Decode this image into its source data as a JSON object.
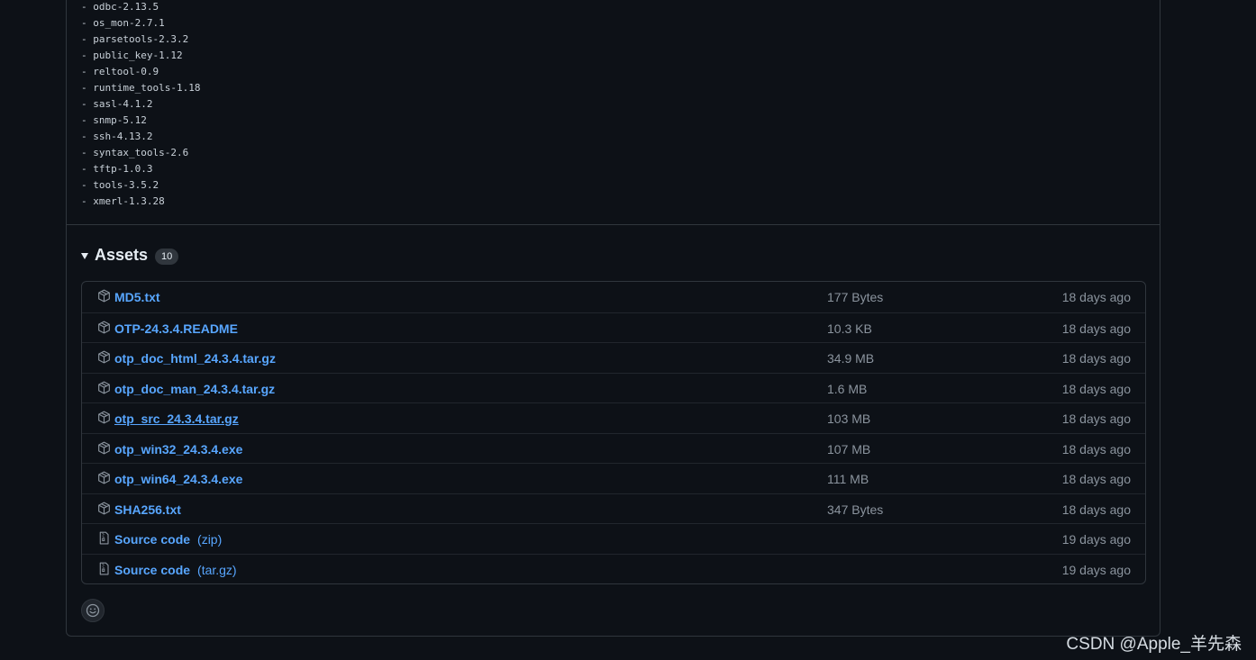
{
  "release_notes": [
    "- odbc-2.13.5",
    "- os_mon-2.7.1",
    "- parsetools-2.3.2",
    "- public_key-1.12",
    "- reltool-0.9",
    "- runtime_tools-1.18",
    "- sasl-4.1.2",
    "- snmp-5.12",
    "- ssh-4.13.2",
    "- syntax_tools-2.6",
    "- tftp-1.0.3",
    "- tools-3.5.2",
    "- xmerl-1.3.28"
  ],
  "assets": {
    "title": "Assets",
    "count": "10",
    "items": [
      {
        "name": "MD5.txt",
        "suffix": "",
        "size": "177 Bytes",
        "date": "18 days ago",
        "icon": "package-icon"
      },
      {
        "name": "OTP-24.3.4.README",
        "suffix": "",
        "size": "10.3 KB",
        "date": "18 days ago",
        "icon": "package-icon"
      },
      {
        "name": "otp_doc_html_24.3.4.tar.gz",
        "suffix": "",
        "size": "34.9 MB",
        "date": "18 days ago",
        "icon": "package-icon"
      },
      {
        "name": "otp_doc_man_24.3.4.tar.gz",
        "suffix": "",
        "size": "1.6 MB",
        "date": "18 days ago",
        "icon": "package-icon"
      },
      {
        "name": "otp_src_24.3.4.tar.gz",
        "suffix": "",
        "size": "103 MB",
        "date": "18 days ago",
        "icon": "package-icon"
      },
      {
        "name": "otp_win32_24.3.4.exe",
        "suffix": "",
        "size": "107 MB",
        "date": "18 days ago",
        "icon": "package-icon"
      },
      {
        "name": "otp_win64_24.3.4.exe",
        "suffix": "",
        "size": "111 MB",
        "date": "18 days ago",
        "icon": "package-icon"
      },
      {
        "name": "SHA256.txt",
        "suffix": "",
        "size": "347 Bytes",
        "date": "18 days ago",
        "icon": "package-icon"
      },
      {
        "name": "Source code",
        "suffix": "(zip)",
        "size": "",
        "date": "19 days ago",
        "icon": "file-zip-icon"
      },
      {
        "name": "Source code",
        "suffix": "(tar.gz)",
        "size": "",
        "date": "19 days ago",
        "icon": "file-zip-icon"
      }
    ]
  },
  "reaction": {
    "icon": "smiley-icon"
  },
  "watermark": "CSDN @Apple_羊先森",
  "colors": {
    "background": "#0d1117",
    "border": "#30363d",
    "link": "#58a6ff",
    "muted_text": "#8b949e",
    "text": "#c9d1d9"
  }
}
